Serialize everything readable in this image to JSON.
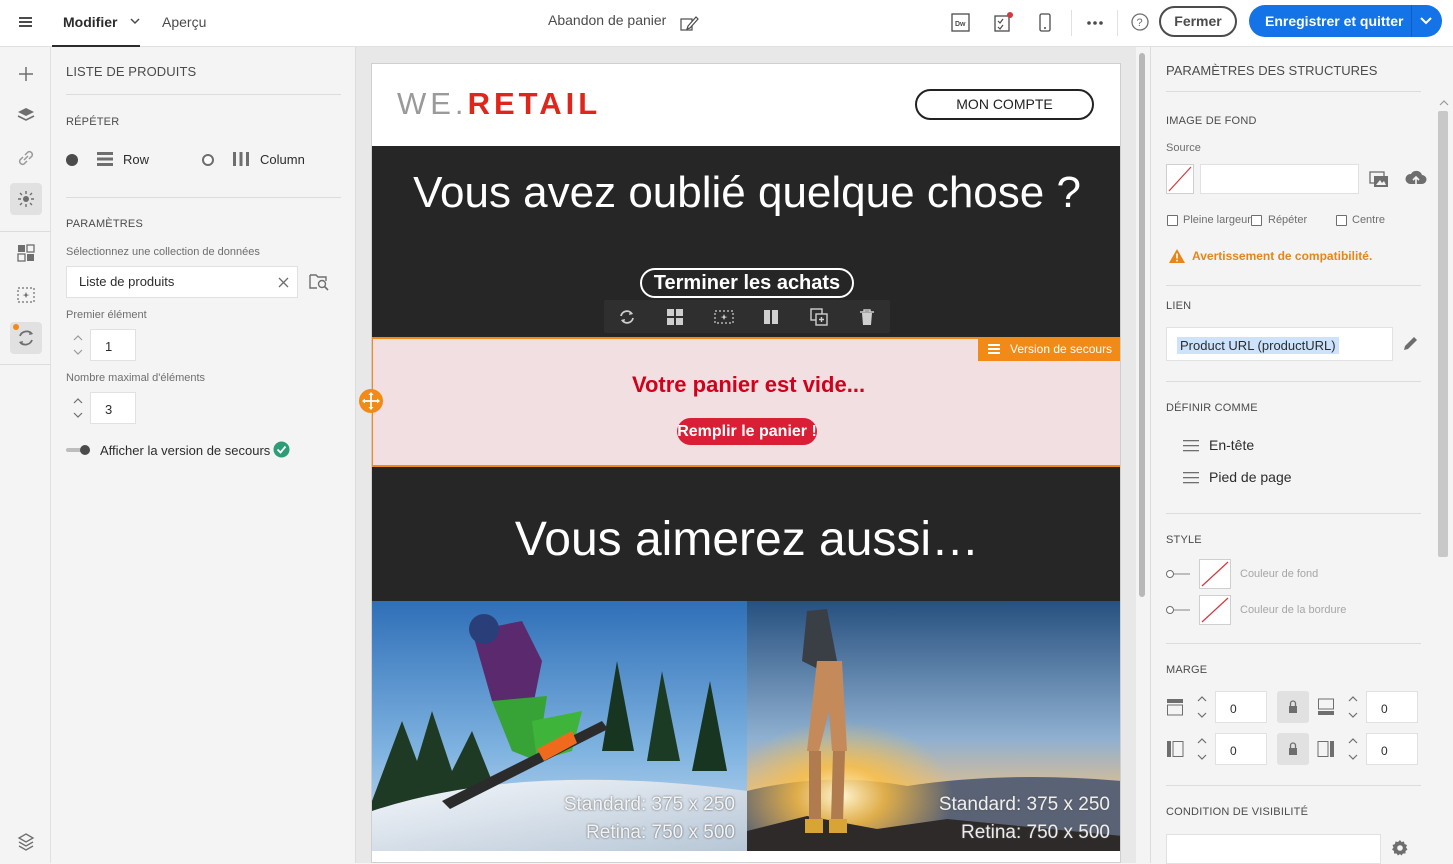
{
  "topbar": {
    "tab_modifier": "Modifier",
    "tab_apercu": "Aperçu",
    "title": "Abandon de panier",
    "btn_close": "Fermer",
    "btn_save": "Enregistrer et quitter"
  },
  "left_panel": {
    "title": "LISTE DE PRODUITS",
    "repeat_section": "RÉPÉTER",
    "repeat_row": "Row",
    "repeat_column": "Column",
    "params_section": "PARAMÈTRES",
    "collection_label": "Sélectionnez une collection de données",
    "collection_value": "Liste de produits",
    "first_label": "Premier élément",
    "first_value": "1",
    "max_label": "Nombre maximal d'éléments",
    "max_value": "3",
    "fallback_toggle": "Afficher la version de secours"
  },
  "email": {
    "logo_we": "WE.",
    "logo_retail": "RETAIL",
    "btn_account": "MON COMPTE",
    "hero_title": "Vous avez oublié quelque chose ?",
    "btn_finish": "Terminer les achats",
    "fallback_badge": "Version de secours",
    "fallback_title": "Votre panier est vide...",
    "btn_fill": "Remplir le panier !",
    "reco_title": "Vous aimerez aussi…",
    "img1_line1": "Standard: 375 x 250",
    "img1_line2": "Retina: 750 x 500",
    "img2_line1": "Standard: 375 x 250",
    "img2_line2": "Retina: 750 x 500"
  },
  "right_panel": {
    "title": "PARAMÈTRES DES STRUCTURES",
    "bg_section": "IMAGE DE FOND",
    "source_label": "Source",
    "cb_full_width": "Pleine largeur",
    "cb_repeat": "Répéter",
    "cb_center": "Centre",
    "warning": "Avertissement de compatibilité.",
    "link_section": "LIEN",
    "link_value": "Product URL (productURL)",
    "define_section": "DÉFINIR COMME",
    "define_header": "En-tête",
    "define_footer": "Pied de page",
    "style_section": "STYLE",
    "bg_color": "Couleur de fond",
    "border_color": "Couleur de la bordure",
    "margin_section": "MARGE",
    "margin_top": "0",
    "margin_bottom": "0",
    "margin_left": "0",
    "margin_right": "0",
    "visibility_section": "CONDITION DE VISIBILITÉ"
  },
  "colors": {
    "accent": "#1473e6",
    "fallback_border": "#f18a16",
    "fallback_bg": "#f1dfe1",
    "brand_red": "#e1251b",
    "warning": "#e68619"
  }
}
